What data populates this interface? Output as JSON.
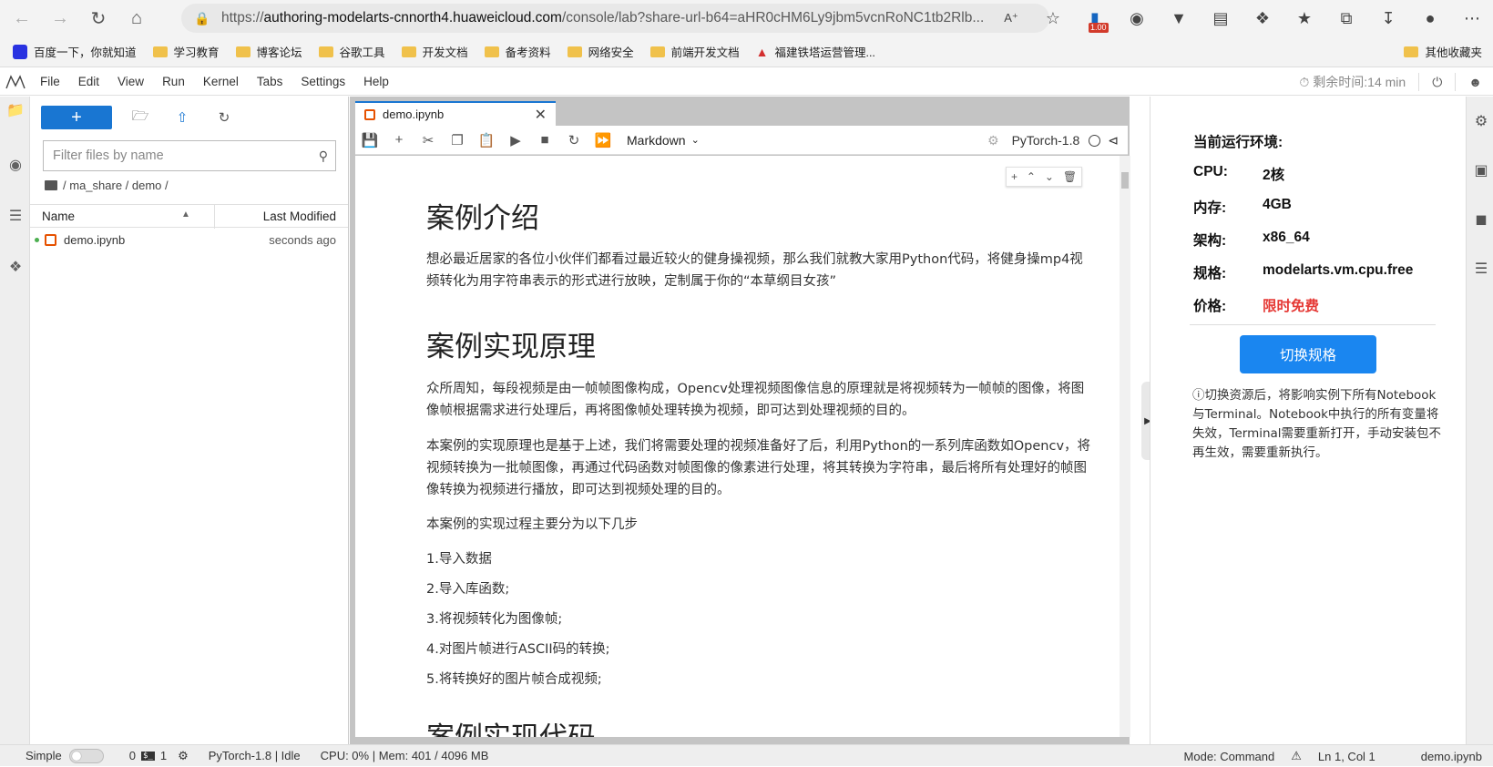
{
  "browser": {
    "url_prefix": "https://",
    "url_host": "authoring-modelarts-cnnorth4.huaweicloud.com",
    "url_path": "/console/lab?share-url-b64=aHR0cHM6Ly9jbm5vcnRoNC1tb2Rlb...",
    "badge": "1.00"
  },
  "bookmarks": [
    {
      "label": "百度一下，你就知道",
      "icon": "baidu-icon"
    },
    {
      "label": "学习教育",
      "icon": "folder-icon"
    },
    {
      "label": "博客论坛",
      "icon": "folder-icon"
    },
    {
      "label": "谷歌工具",
      "icon": "folder-icon"
    },
    {
      "label": "开发文档",
      "icon": "folder-icon"
    },
    {
      "label": "备考资料",
      "icon": "folder-icon"
    },
    {
      "label": "网络安全",
      "icon": "folder-icon"
    },
    {
      "label": "前端开发文档",
      "icon": "folder-icon"
    },
    {
      "label": "福建铁塔运营管理...",
      "icon": "tower-icon"
    }
  ],
  "bookmarks_other": "其他收藏夹",
  "menu": [
    "File",
    "Edit",
    "View",
    "Run",
    "Kernel",
    "Tabs",
    "Settings",
    "Help"
  ],
  "remaining_time": "剩余时间:14 min",
  "filebrowser": {
    "filter_placeholder": "Filter files by name",
    "path": [
      "ma_share",
      "demo"
    ],
    "col_name": "Name",
    "col_modified": "Last Modified",
    "files": [
      {
        "name": "demo.ipynb",
        "modified": "seconds ago"
      }
    ]
  },
  "notebook": {
    "tab_label": "demo.ipynb",
    "cell_type": "Markdown",
    "kernel": "PyTorch-1.8",
    "content": {
      "h1_intro": "案例介绍",
      "p_intro": "想必最近居家的各位小伙伴们都看过最近较火的健身操视频，那么我们就教大家用Python代码，将健身操mp4视频转化为用字符串表示的形式进行放映，定制属于你的“本草纲目女孩”",
      "h1_principle": "案例实现原理",
      "p_principle1": "众所周知，每段视频是由一帧帧图像构成，Opencv处理视频图像信息的原理就是将视频转为一帧帧的图像，将图像帧根据需求进行处理后，再将图像帧处理转换为视频，即可达到处理视频的目的。",
      "p_principle2": "本案例的实现原理也是基于上述，我们将需要处理的视频准备好了后，利用Python的一系列库函数如Opencv，将视频转换为一批帧图像，再通过代码函数对帧图像的像素进行处理，将其转换为字符串，最后将所有处理好的帧图像转换为视频进行播放，即可达到视频处理的目的。",
      "p_steps_intro": "本案例的实现过程主要分为以下几步",
      "steps": [
        "1.导入数据",
        "2.导入库函数;",
        "3.将视频转化为图像帧;",
        "4.对图片帧进行ASCII码的转换;",
        "5.将转换好的图片帧合成视频;"
      ],
      "h1_code": "案例实现代码"
    }
  },
  "env_panel": {
    "title": "当前运行环境:",
    "rows": [
      {
        "key": "CPU:",
        "value": "2核"
      },
      {
        "key": "内存:",
        "value": "4GB"
      },
      {
        "key": "架构:",
        "value": "x86_64"
      },
      {
        "key": "规格:",
        "value": "modelarts.vm.cpu.free"
      },
      {
        "key": "价格:",
        "value": "限时免费"
      }
    ],
    "price_color": "#e53935",
    "switch_button": "切换规格",
    "note": "切换资源后，将影响实例下所有Notebook与Terminal。Notebook中执行的所有变量将失效，Terminal需要重新打开，手动安装包不再生效，需要重新执行。"
  },
  "statusbar": {
    "simple": "Simple",
    "count0": "0",
    "count1": "1",
    "kernel_status": "PyTorch-1.8 | Idle",
    "resources": "CPU: 0% | Mem: 401 / 4096 MB",
    "mode": "Mode: Command",
    "position": "Ln 1, Col 1",
    "file": "demo.ipynb"
  }
}
